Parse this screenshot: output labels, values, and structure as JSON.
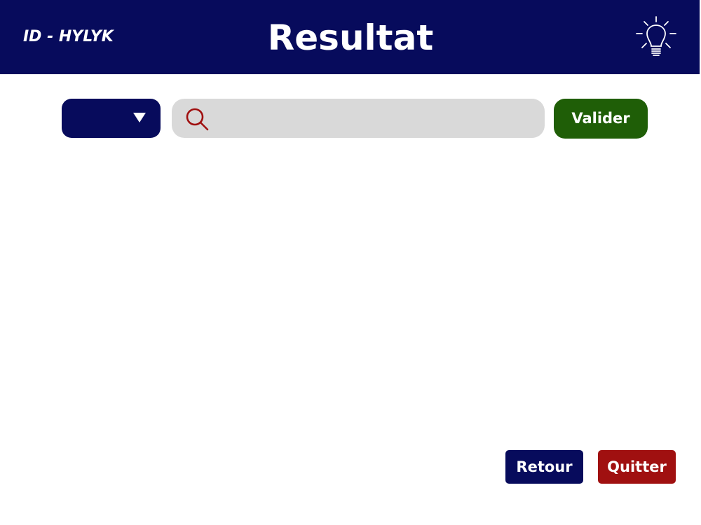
{
  "header": {
    "app_id": "ID - HYLYK",
    "title": "Resultat",
    "hint_icon": "lightbulb-icon",
    "background_color": "#070b5c"
  },
  "search_bar": {
    "dropdown": {
      "selected_value": "",
      "icon": "chevron-down-icon",
      "color": "#070b5c"
    },
    "search": {
      "icon": "search-icon",
      "value": "",
      "placeholder": "",
      "icon_color": "#a01010"
    },
    "submit_label": "Valider",
    "submit_color": "#1f5e07"
  },
  "footer": {
    "back_label": "Retour",
    "back_color": "#070b5c",
    "quit_label": "Quitter",
    "quit_color": "#a01010"
  }
}
